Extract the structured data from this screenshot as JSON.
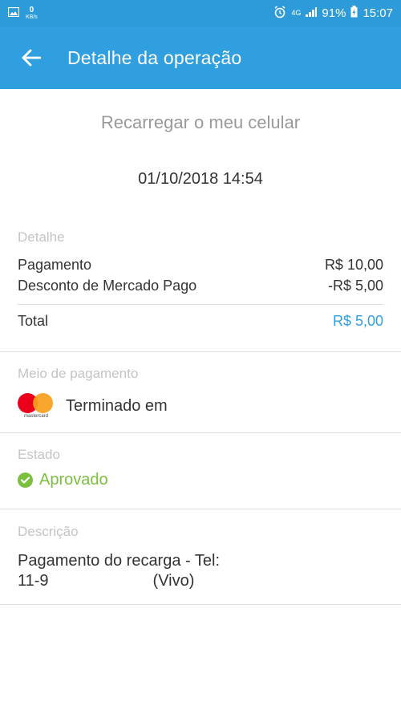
{
  "status_bar": {
    "data_speed": "0",
    "data_unit": "KB/s",
    "network": "4G",
    "battery": "91%",
    "time": "15:07"
  },
  "app_bar": {
    "title": "Detalhe da operação"
  },
  "hero": {
    "title": "Recarregar o meu celular",
    "datetime": "01/10/2018 14:54"
  },
  "details": {
    "label": "Detalhe",
    "items": [
      {
        "label": "Pagamento",
        "value": "R$ 10,00"
      },
      {
        "label": "Desconto de Mercado Pago",
        "value": "-R$ 5,00"
      }
    ],
    "total_label": "Total",
    "total_value": "R$ 5,00"
  },
  "payment_method": {
    "label": "Meio de pagamento",
    "card_brand": "mastercard",
    "text": "Terminado em"
  },
  "state": {
    "label": "Estado",
    "value": "Aprovado"
  },
  "description": {
    "label": "Descrição",
    "line1": "Pagamento do recarga - Tel:",
    "line2_prefix": "11-9",
    "line2_suffix": "(Vivo)"
  },
  "colors": {
    "primary": "#2f9fe0",
    "success": "#7bbf3f",
    "mastercard_red": "#eb001b",
    "mastercard_yellow": "#f79e1b"
  }
}
